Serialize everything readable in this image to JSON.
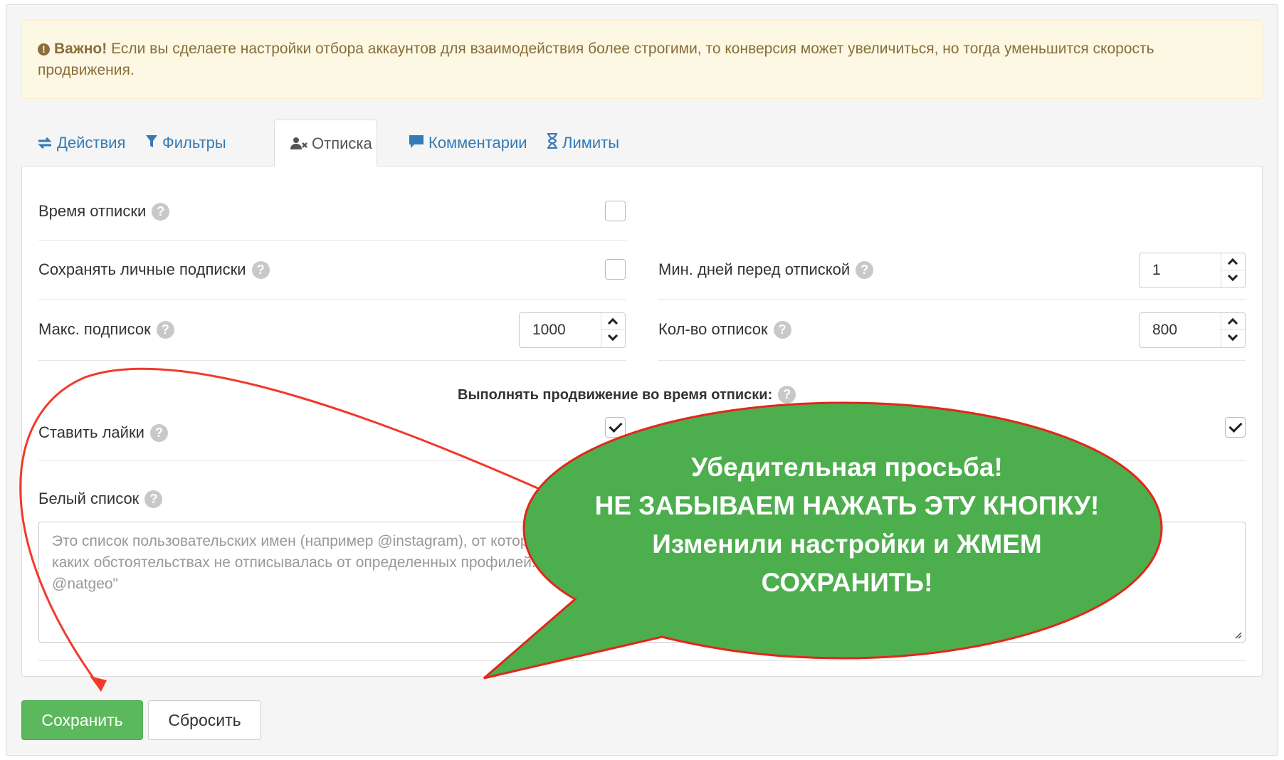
{
  "alert": {
    "strong": "Важно!",
    "text": " Если вы сделаете настройки отбора аккаунтов для взаимодействия более строгими, то конверсия может увеличиться, но тогда уменьшится скорость продвижения."
  },
  "tabs": [
    {
      "label": "Действия",
      "icon": "exchange-icon"
    },
    {
      "label": "Фильтры",
      "icon": "filter-icon"
    },
    {
      "label": "Отписка",
      "icon": "user-times-icon",
      "active": true
    },
    {
      "label": "Комментарии",
      "icon": "comment-icon"
    },
    {
      "label": "Лимиты",
      "icon": "hourglass-icon"
    }
  ],
  "form": {
    "unfollow_time": {
      "label": "Время отписки",
      "checked": false
    },
    "keep_personal": {
      "label": "Сохранять личные подписки",
      "checked": false
    },
    "min_days": {
      "label": "Мин. дней перед отпиской",
      "value": "1"
    },
    "max_follows": {
      "label": "Макс. подписок",
      "value": "1000"
    },
    "unfollow_count": {
      "label": "Кол-во отписок",
      "value": "800"
    },
    "promo_title": "Выполнять продвижение во время отписки:",
    "likes": {
      "label": "Ставить лайки",
      "checked": true
    },
    "right_option": {
      "checked": true
    },
    "whitelist": {
      "label": "Белый список",
      "placeholder_line1": "Это список пользовательских имен (например @instagram), от которых вы хотите, чтобы система ни при",
      "placeholder_line2": "каких обстоятельствах не отписывалась от определенных профилей. Например: \"@instagram @instagood",
      "placeholder_line3": "@natgeo\""
    }
  },
  "buttons": {
    "save": "Сохранить",
    "reset": "Сбросить"
  },
  "callout": {
    "line1": "Убедительная просьба!",
    "line2": "НЕ ЗАБЫВАЕМ НАЖАТЬ ЭТУ КНОПКУ!",
    "line3": "Изменили настройки и ЖМЕМ",
    "line4": "СОХРАНИТЬ!"
  },
  "colors": {
    "bubble": "#4cae4c",
    "arrow": "#f03a2a",
    "link": "#337ab7",
    "save_button": "#5cb85c"
  }
}
